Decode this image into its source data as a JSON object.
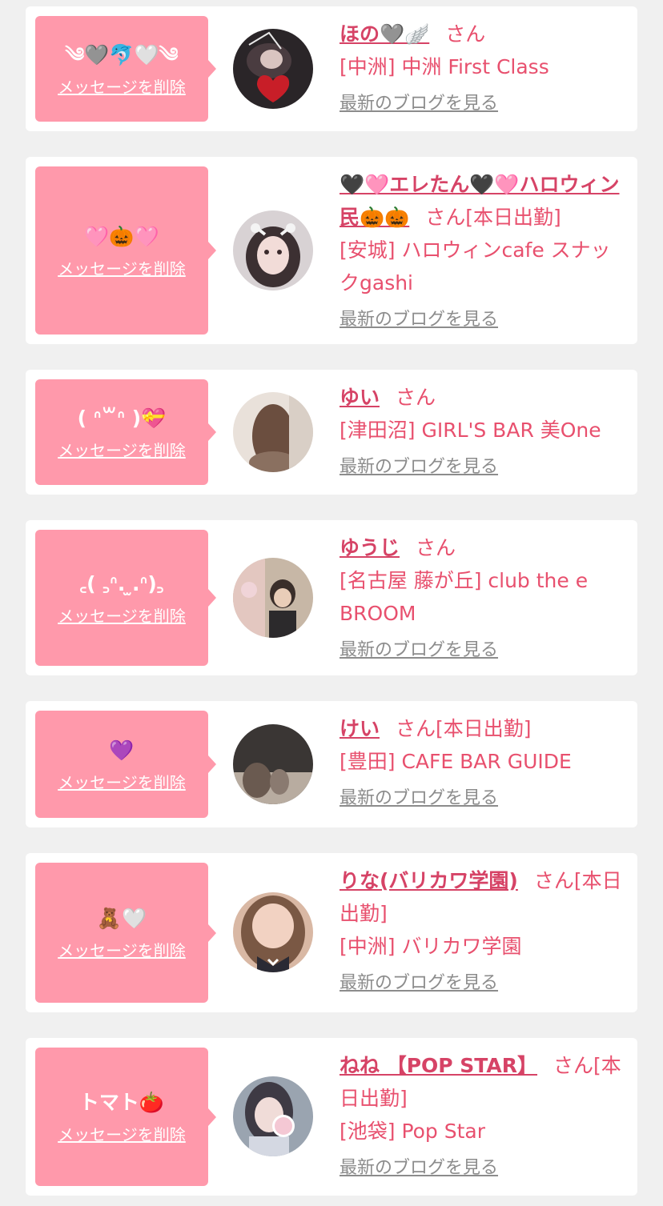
{
  "common": {
    "delete_label": "メッセージを削除",
    "san_label": "さん",
    "blog_label": "最新のブログを見る"
  },
  "colors": {
    "bubble": "#ff99ab",
    "name": "#d64366",
    "text": "#e8506e",
    "link": "#8c8c8c",
    "card": "#ffffff",
    "background": "#f0f0f0"
  },
  "items": [
    {
      "message": "༄🩶🐬🤍༄",
      "name": "ほの🩶🪽",
      "status": "",
      "shop": "[中洲] 中洲 First Class"
    },
    {
      "message": "🩷🎃🩷",
      "name": "🖤🩷エレたん🖤🩷ハロウィン民🎃🎃",
      "status": "[本日出勤]",
      "shop": "[安城] ハロウィンcafe スナックgashi"
    },
    {
      "message": "( ᐢ꒳ᐢ )💝",
      "name": "ゆい",
      "status": "",
      "shop": "[津田沼] GIRL'S BAR 美One"
    },
    {
      "message": "꜀( ꜆ᐢ. ̫.ᐢ)꜆",
      "name": "ゆうじ",
      "status": "",
      "shop": "[名古屋 藤が丘] club the e BROOM"
    },
    {
      "message": "💜",
      "name": "けい",
      "status": "[本日出勤]",
      "shop": "[豊田] CAFE BAR GUIDE"
    },
    {
      "message": "🧸🤍",
      "name": "りな(バリカワ学園)",
      "status": "[本日出勤]",
      "shop": "[中洲] バリカワ学園"
    },
    {
      "message": "トマト🍅",
      "name": "ねね 【POP STAR】",
      "status": "[本日出勤]",
      "shop": "[池袋] Pop Star"
    }
  ]
}
